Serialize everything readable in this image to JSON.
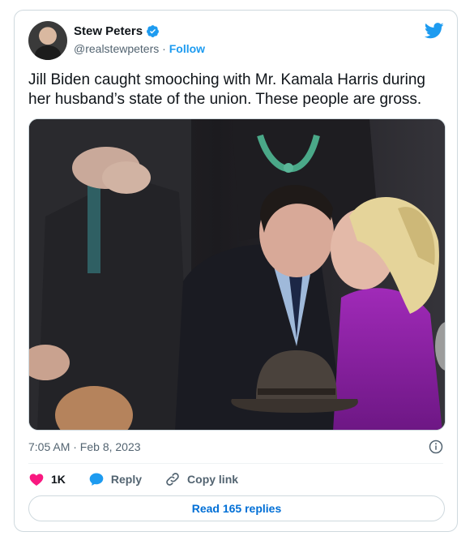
{
  "author": {
    "name": "Stew Peters",
    "handle": "@realstewpeters",
    "separator": "·",
    "follow_label": "Follow"
  },
  "tweet": {
    "text": "Jill Biden caught smooching with Mr. Kamala Harris during her husband’s state of the union. These people are gross.",
    "timestamp": "7:05 AM · Feb 8, 2023"
  },
  "actions": {
    "like_count": "1K",
    "reply_label": "Reply",
    "copy_label": "Copy link"
  },
  "replies_button": "Read 165 replies",
  "icons": {
    "avatar": "avatar",
    "verified": "verified-badge-icon",
    "logo": "twitter-bird-icon",
    "info": "info-icon",
    "like": "heart-icon",
    "reply": "speech-bubble-icon",
    "copy": "link-icon"
  },
  "colors": {
    "accent": "#1d9bf0",
    "like": "#f91880",
    "text": "#0f1419",
    "muted": "#536471",
    "border": "#cfd9de",
    "replies_link": "#006fd6"
  }
}
